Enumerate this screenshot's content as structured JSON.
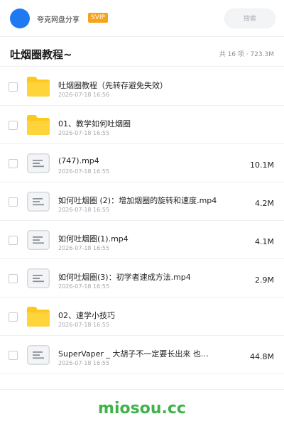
{
  "header": {
    "user_name": "夸克网盘分享",
    "vip_label": "SVIP",
    "search_label": "搜索"
  },
  "folder": {
    "title": "吐烟圈教程~",
    "meta": "共 16 项 · 723.3M"
  },
  "files": [
    {
      "type": "folder",
      "icon": "folder-icon",
      "name": "吐烟圈教程（先转存避免失效）",
      "date": "2026-07-18 16:56",
      "size": ""
    },
    {
      "type": "folder",
      "icon": "folder-icon",
      "name": "01、教学如何吐烟圈",
      "date": "2026-07-18 16:55",
      "size": ""
    },
    {
      "type": "file",
      "icon": "file-icon",
      "name": "(747).mp4",
      "date": "2026-07-18 16:55",
      "size": "10.1M"
    },
    {
      "type": "file",
      "icon": "file-icon",
      "name": "如何吐烟圈 (2)：增加烟圈的旋转和速度.mp4",
      "date": "2026-07-18 16:55",
      "size": "4.2M"
    },
    {
      "type": "file",
      "icon": "file-icon",
      "name": "如何吐烟圈(1).mp4",
      "date": "2026-07-18 16:55",
      "size": "4.1M"
    },
    {
      "type": "file",
      "icon": "file-icon",
      "name": "如何吐烟圈(3)：初学者速成方法.mp4",
      "date": "2026-07-18 16:55",
      "size": "2.9M"
    },
    {
      "type": "folder",
      "icon": "folder-icon",
      "name": "02、速学小技巧",
      "date": "2026-07-18 16:55",
      "size": ""
    },
    {
      "type": "file",
      "icon": "file-icon",
      "name": "SuperVaper _ 大胡子不一定要长出来 也…",
      "date": "2026-07-18 16:55",
      "size": "44.8M"
    }
  ],
  "footer": {
    "watermark": "miosou.cc"
  },
  "colors": {
    "accent": "#1f7af2",
    "vip": "#f7a21b",
    "folder": "#ffc81e",
    "watermark": "#3fb24a"
  }
}
